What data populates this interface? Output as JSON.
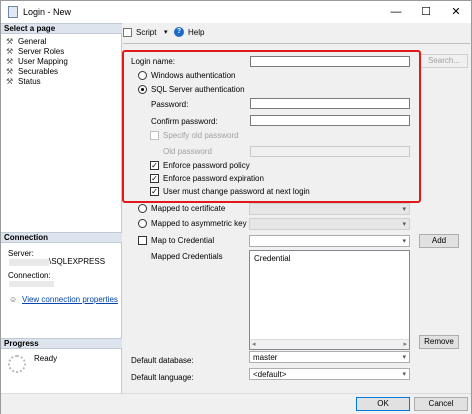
{
  "window": {
    "title": "Login - New",
    "minimize": "—",
    "maximize": "☐",
    "close": "✕"
  },
  "left": {
    "select_page_header": "Select a page",
    "pages": [
      "General",
      "Server Roles",
      "User Mapping",
      "Securables",
      "Status"
    ],
    "connection_header": "Connection",
    "server_label": "Server:",
    "server_value": "\\SQLEXPRESS",
    "connection_label": "Connection:",
    "view_conn_link": "View connection properties",
    "progress_header": "Progress",
    "progress_status": "Ready"
  },
  "toolbar": {
    "script": "Script",
    "help": "Help"
  },
  "form": {
    "login_name_label": "Login name:",
    "login_name_value": "",
    "search_button": "Search...",
    "windows_auth": "Windows authentication",
    "sql_auth": "SQL Server authentication",
    "password_label": "Password:",
    "confirm_password_label": "Confirm password:",
    "specify_old_password": "Specify old password",
    "old_password_label": "Old password",
    "enforce_policy": "Enforce password policy",
    "enforce_expiration": "Enforce password expiration",
    "must_change": "User must change password at next login",
    "mapped_cert": "Mapped to certificate",
    "mapped_asym": "Mapped to asymmetric key",
    "map_credential": "Map to Credential",
    "add_button": "Add",
    "mapped_credentials_label": "Mapped Credentials",
    "credential_col": "Credential",
    "remove_button": "Remove",
    "default_db_label": "Default database:",
    "default_db_value": "master",
    "default_lang_label": "Default language:",
    "default_lang_value": "<default>"
  },
  "footer": {
    "ok": "OK",
    "cancel": "Cancel"
  }
}
